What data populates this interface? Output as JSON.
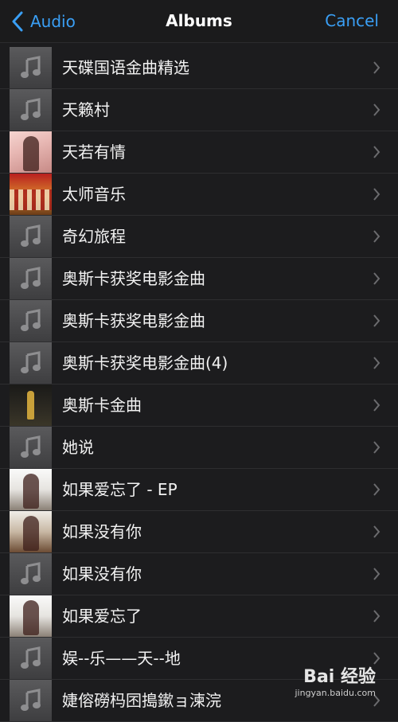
{
  "nav": {
    "back_label": "Audio",
    "title": "Albums",
    "cancel_label": "Cancel"
  },
  "albums": [
    {
      "title": "天碟国语金曲精选",
      "art": "music-note-icon"
    },
    {
      "title": "天籁村",
      "art": "music-note-icon"
    },
    {
      "title": "天若有情",
      "art": "album-cover-photo"
    },
    {
      "title": "太师音乐",
      "art": "album-cover-photo"
    },
    {
      "title": "奇幻旅程",
      "art": "music-note-icon"
    },
    {
      "title": "奥斯卡获奖电影金曲",
      "art": "music-note-icon"
    },
    {
      "title": "奥斯卡获奖电影金曲",
      "art": "music-note-icon"
    },
    {
      "title": "奥斯卡获奖电影金曲(4)",
      "art": "music-note-icon"
    },
    {
      "title": "奥斯卡金曲",
      "art": "album-cover-photo"
    },
    {
      "title": "她说",
      "art": "music-note-icon"
    },
    {
      "title": "如果爱忘了 - EP",
      "art": "album-cover-photo"
    },
    {
      "title": "如果没有你",
      "art": "album-cover-photo"
    },
    {
      "title": "如果没有你",
      "art": "music-note-icon"
    },
    {
      "title": "如果爱忘了",
      "art": "album-cover-photo"
    },
    {
      "title": "娱--乐——天--地",
      "art": "music-note-icon"
    },
    {
      "title": "婕傛磱杩囨搗鏉ョ湅浣",
      "art": "music-note-icon"
    }
  ],
  "watermark": {
    "line1": "Bai 经验",
    "line2": "jingyan.baidu.com"
  },
  "colors": {
    "accent": "#3a9ff5",
    "background": "#1c1c1e",
    "separator": "#2e2e30"
  }
}
